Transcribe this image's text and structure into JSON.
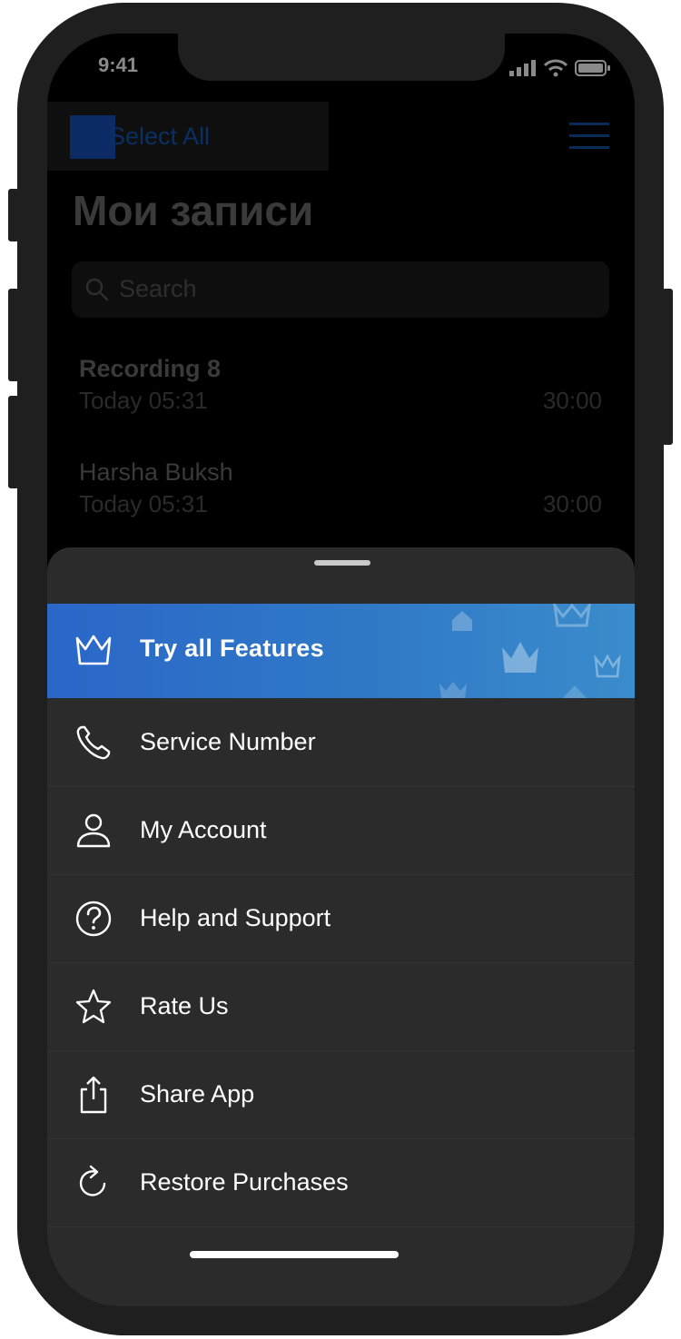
{
  "status_bar": {
    "time": "9:41"
  },
  "header": {
    "select_all": "Select All"
  },
  "page": {
    "title": "Мои записи"
  },
  "search": {
    "placeholder": "Search"
  },
  "recordings": [
    {
      "title": "Recording 8",
      "date": "Today 05:31",
      "duration": "30:00"
    },
    {
      "title": "Harsha Buksh",
      "date": "Today 05:31",
      "duration": "30:00"
    }
  ],
  "menu": {
    "promo": {
      "label": "Try all Features",
      "icon": "crown-icon"
    },
    "items": [
      {
        "label": "Service Number",
        "icon": "phone-icon"
      },
      {
        "label": "My Account",
        "icon": "user-icon"
      },
      {
        "label": "Help and Support",
        "icon": "help-icon"
      },
      {
        "label": "Rate Us",
        "icon": "star-icon"
      },
      {
        "label": "Share App",
        "icon": "share-icon"
      },
      {
        "label": "Restore Purchases",
        "icon": "restore-icon"
      }
    ]
  },
  "colors": {
    "accent": "#2a67c9",
    "sheet": "#2b2b2b",
    "background": "#000000"
  }
}
